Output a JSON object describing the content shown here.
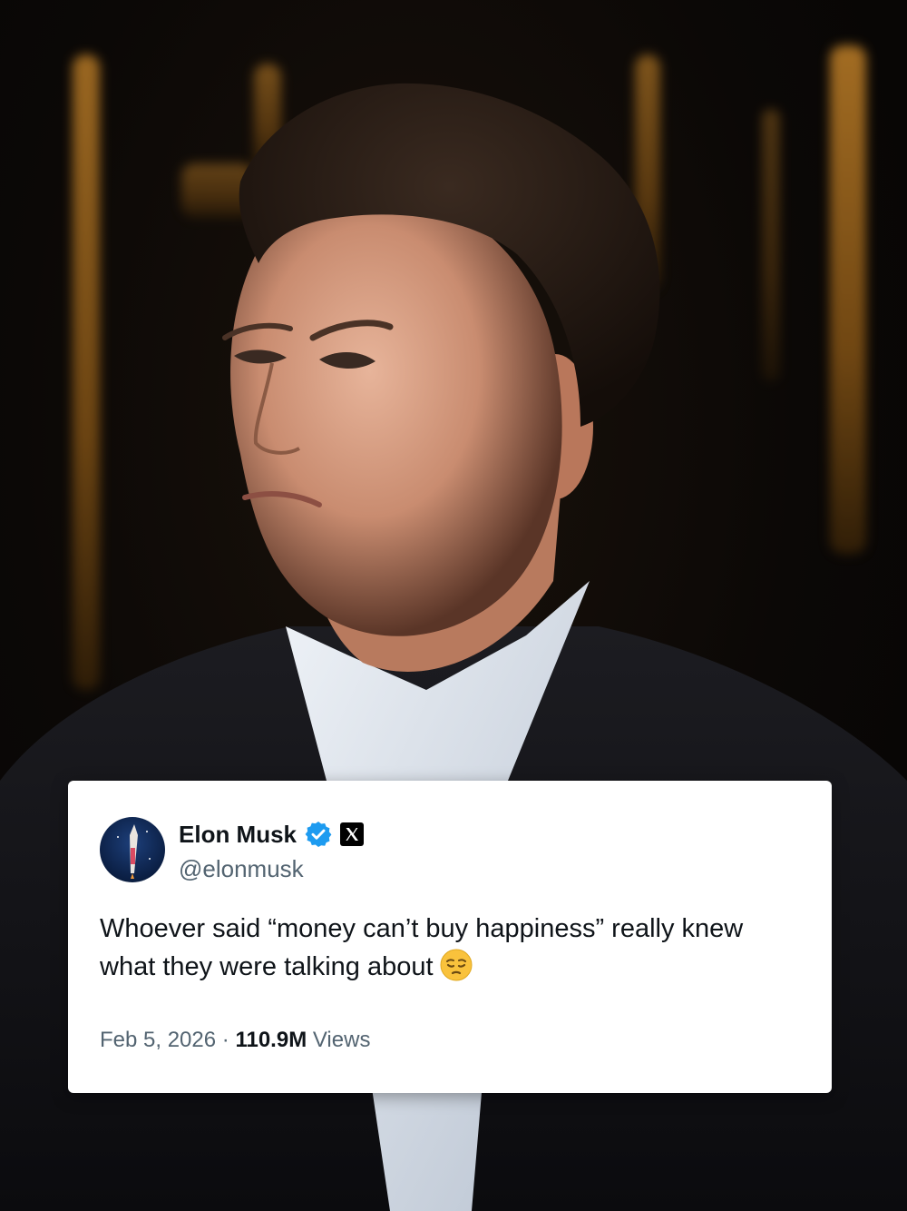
{
  "tweet": {
    "name": "Elon Musk",
    "handle": "@elonmusk",
    "text": "Whoever said “money can’t buy happiness” really knew what they were talking about",
    "date": "Feb 5, 2026",
    "separator": "·",
    "views_count": "110.9M",
    "views_label": "Views"
  },
  "icons": {
    "verified": "verified-badge-icon",
    "platform": "x-logo-icon",
    "emoji": "pensive-face-emoji"
  },
  "colors": {
    "verified_blue": "#1d9bf0",
    "text_primary": "#0f1419",
    "text_secondary": "#536471",
    "emoji_yellow": "#f9c23c"
  }
}
